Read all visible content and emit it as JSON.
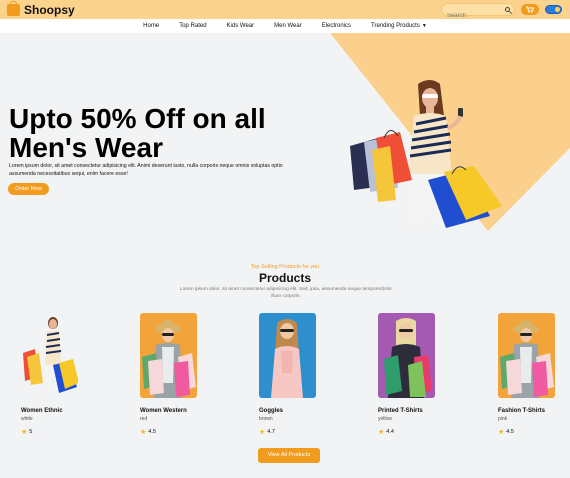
{
  "app": {
    "name": "Shoopsy"
  },
  "search": {
    "placeholder": "Search"
  },
  "nav": {
    "items": [
      "Home",
      "Top Rated",
      "Kids Wear",
      "Men Wear",
      "Electronics"
    ],
    "dropdown_label": "Trending Products"
  },
  "hero": {
    "title": "Upto 50% Off on all Men's Wear",
    "description": "Lorem ipsum dolor, sit amet consectetur adipisicing elit. Animi deserunt iusto, nulla corporis neque omnis voluptas optio assumenda necessitatibus sequi, enim facere esse!",
    "cta": "Order Now"
  },
  "products_section": {
    "subtitle": "Top Selling Products for you",
    "title": "Products",
    "description": "Lorem ipsum dolor, sit amet consectetur adipisicing elit. Sed, ipsa, assumenda neque tempore/dolor illum corporis."
  },
  "products": [
    {
      "name": "Women Ethnic",
      "color": "white",
      "rating": "5"
    },
    {
      "name": "Women Western",
      "color": "red",
      "rating": "4.5"
    },
    {
      "name": "Goggles",
      "color": "brown",
      "rating": "4.7"
    },
    {
      "name": "Printed T-Shirts",
      "color": "yellow",
      "rating": "4.4"
    },
    {
      "name": "Fashion T-Shirts",
      "color": "pink",
      "rating": "4.5"
    }
  ],
  "view_all": "View All Products",
  "colors": {
    "accent": "#f29c1f",
    "topbar": "#fcd38c",
    "hero_shape": "#fbd08c"
  }
}
